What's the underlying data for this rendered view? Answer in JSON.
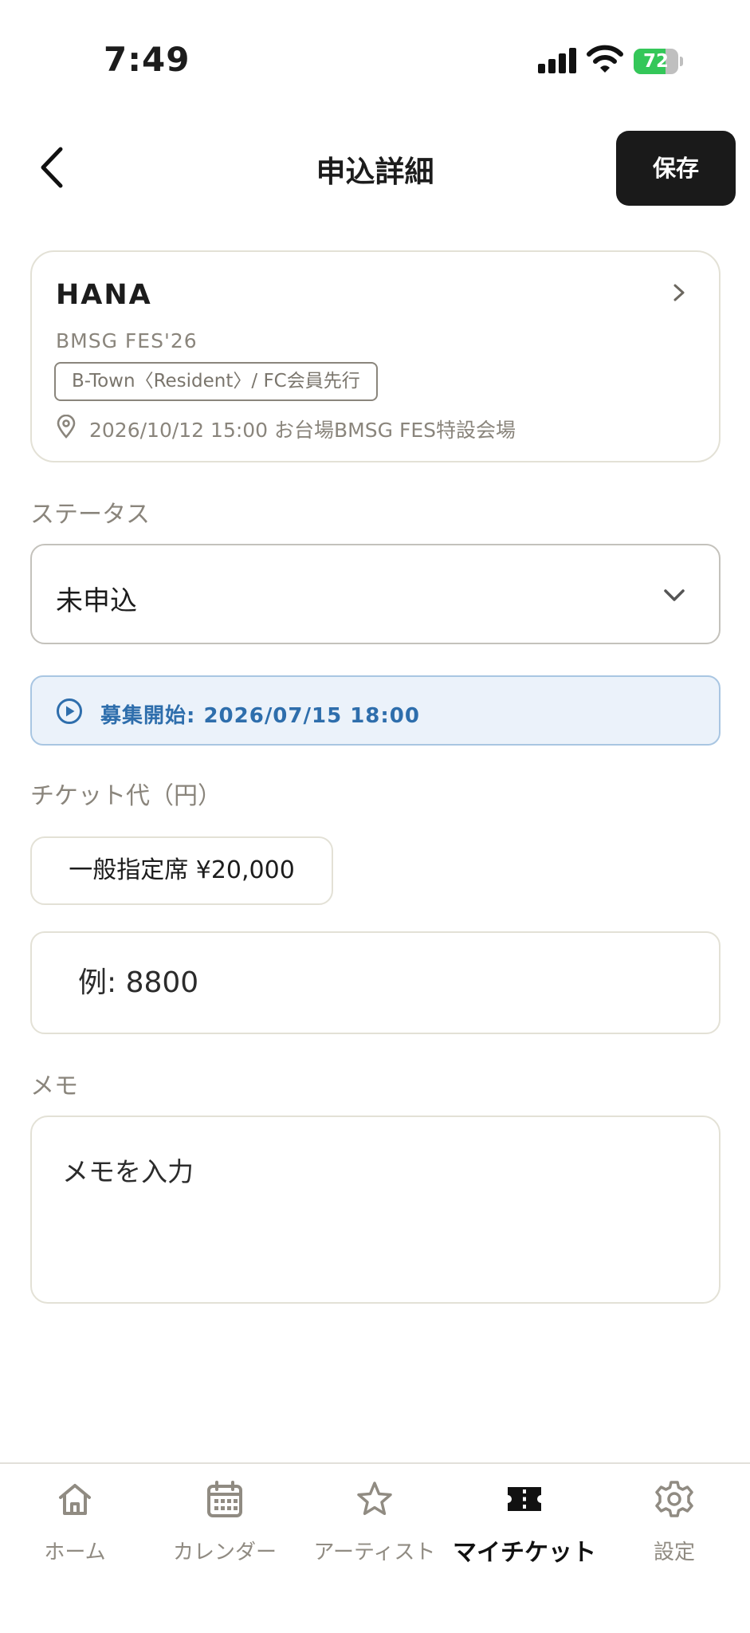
{
  "status_bar": {
    "time": "7:49",
    "battery_level": "72",
    "battery_fraction": 0.72
  },
  "header": {
    "title": "申込詳細",
    "save_label": "保存"
  },
  "event": {
    "artist": "HANA",
    "name": "BMSG FES'26",
    "ticket_type": "B-Town〈Resident〉/ FC会員先行",
    "datetime_venue": "2026/10/12 15:00 お台場BMSG FES特設会場"
  },
  "status_section": {
    "label": "ステータス",
    "selected": "未申込"
  },
  "info_banner": {
    "text": "募集開始: 2026/07/15 18:00"
  },
  "price_section": {
    "label": "チケット代（円）",
    "preset": "一般指定席  ¥20,000",
    "input_placeholder": "例: 8800",
    "input_value": ""
  },
  "memo_section": {
    "label": "メモ",
    "placeholder": "メモを入力",
    "value": ""
  },
  "tab_bar": {
    "items": [
      {
        "label": "ホーム",
        "icon": "home-icon",
        "active": false
      },
      {
        "label": "カレンダー",
        "icon": "calendar-icon",
        "active": false
      },
      {
        "label": "アーティスト",
        "icon": "star-icon",
        "active": false
      },
      {
        "label": "マイチケット",
        "icon": "ticket-icon",
        "active": true
      },
      {
        "label": "設定",
        "icon": "gear-icon",
        "active": false
      }
    ]
  },
  "colors": {
    "accent_blue": "#2e6eac",
    "banner_bg": "#ebf2fa",
    "primary_dark": "#1a1a1a",
    "muted_text": "#8a857c",
    "battery_green": "#34c759"
  }
}
